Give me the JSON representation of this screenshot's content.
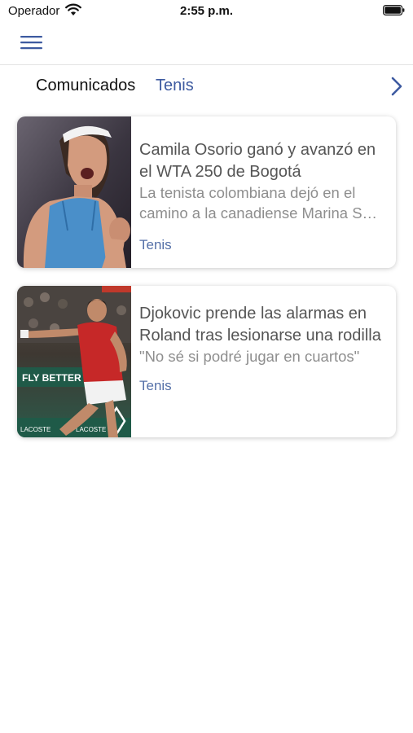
{
  "status_bar": {
    "carrier": "Operador",
    "time": "2:55 p.m."
  },
  "nav": {
    "menu_icon": "hamburger-menu-icon"
  },
  "tabs": [
    {
      "label": "Comunicados",
      "active": true
    },
    {
      "label": "Tenis",
      "active": false
    }
  ],
  "tabs_next_icon": "chevron-right-icon",
  "articles": [
    {
      "headline": "Camila Osorio ganó y avanzó en el WTA 250 de Bogotá",
      "summary": "La tenista colombiana dejó en el camino a la canadiense Marina S…",
      "category": "Tenis"
    },
    {
      "headline": "Djokovic prende las alarmas en Roland tras lesionarse una rodilla",
      "summary": "\"No sé si podré jugar en cuartos\"",
      "category": "Tenis"
    }
  ],
  "photo_signage": [
    "FLY BETTER",
    "LACOSTE",
    "LACOSTE"
  ],
  "colors": {
    "accent": "#3d5aa0",
    "category_text": "#5570a8",
    "headline_text": "#555555",
    "summary_text": "#8e8e8e"
  }
}
